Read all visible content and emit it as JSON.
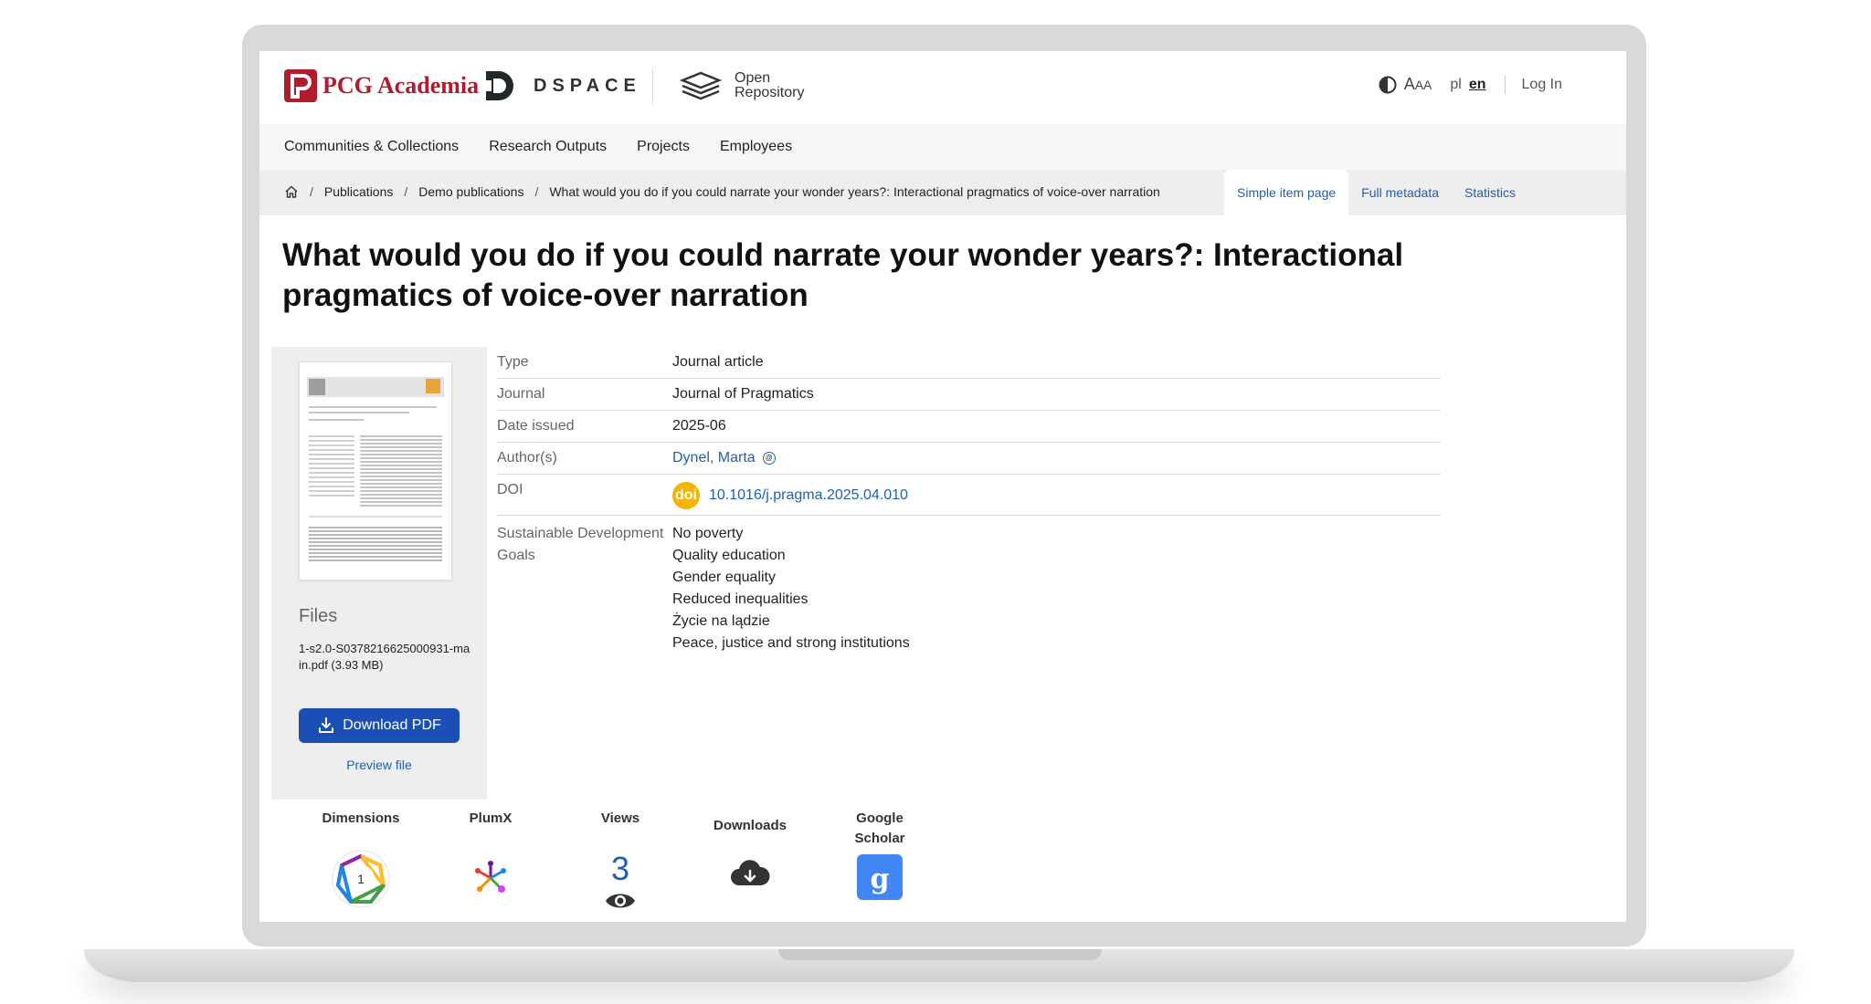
{
  "header": {
    "brand": "PCG Academia",
    "dspace": "DSPACE",
    "open_line1": "Open",
    "open_line2": "Repository",
    "aaa_big": "A",
    "aaa_small": "AA",
    "lang_pl": "pl",
    "lang_en": "en",
    "login": "Log In"
  },
  "nav": {
    "items": [
      "Communities & Collections",
      "Research Outputs",
      "Projects",
      "Employees"
    ]
  },
  "breadcrumb": {
    "items": [
      "Publications",
      "Demo publications",
      "What would you do if you could narrate your wonder years?: Interactional pragmatics of voice-over narration"
    ]
  },
  "tabs": [
    "Simple item page",
    "Full metadata",
    "Statistics"
  ],
  "title": "What would you do if you could narrate your wonder years?: Interactional pragmatics of voice-over narration",
  "files": {
    "heading": "Files",
    "file_name": "1-s2.0-S0378216625000931-main.pdf (3.93 MB)",
    "download_label": "Download PDF",
    "preview_label": "Preview file"
  },
  "metadata": {
    "type_label": "Type",
    "type_value": "Journal article",
    "journal_label": "Journal",
    "journal_value": "Journal of Pragmatics",
    "date_label": "Date issued",
    "date_value": "2025-06",
    "authors_label": "Author(s)",
    "authors_value": "Dynel, Marta",
    "doi_label": "DOI",
    "doi_badge": "doi",
    "doi_value": "10.1016/j.pragma.2025.04.010",
    "sdg_label": "Sustainable Development Goals",
    "sdg_values": [
      "No poverty",
      "Quality education",
      "Gender equality",
      "Reduced inequalities",
      "Życie na lądzie",
      "Peace, justice and strong institutions"
    ]
  },
  "metrics": {
    "dimensions_label": "Dimensions",
    "dimensions_value": "1",
    "plumx_label": "PlumX",
    "views_label": "Views",
    "views_value": "3",
    "downloads_label": "Downloads",
    "scholar_label": "Google Scholar"
  },
  "colors": {
    "brand_red": "#b01c2e",
    "link_blue": "#1f5fb3",
    "button_blue": "#1a4fb5",
    "doi_yellow": "#f4b400",
    "scholar_blue": "#4285f4"
  }
}
